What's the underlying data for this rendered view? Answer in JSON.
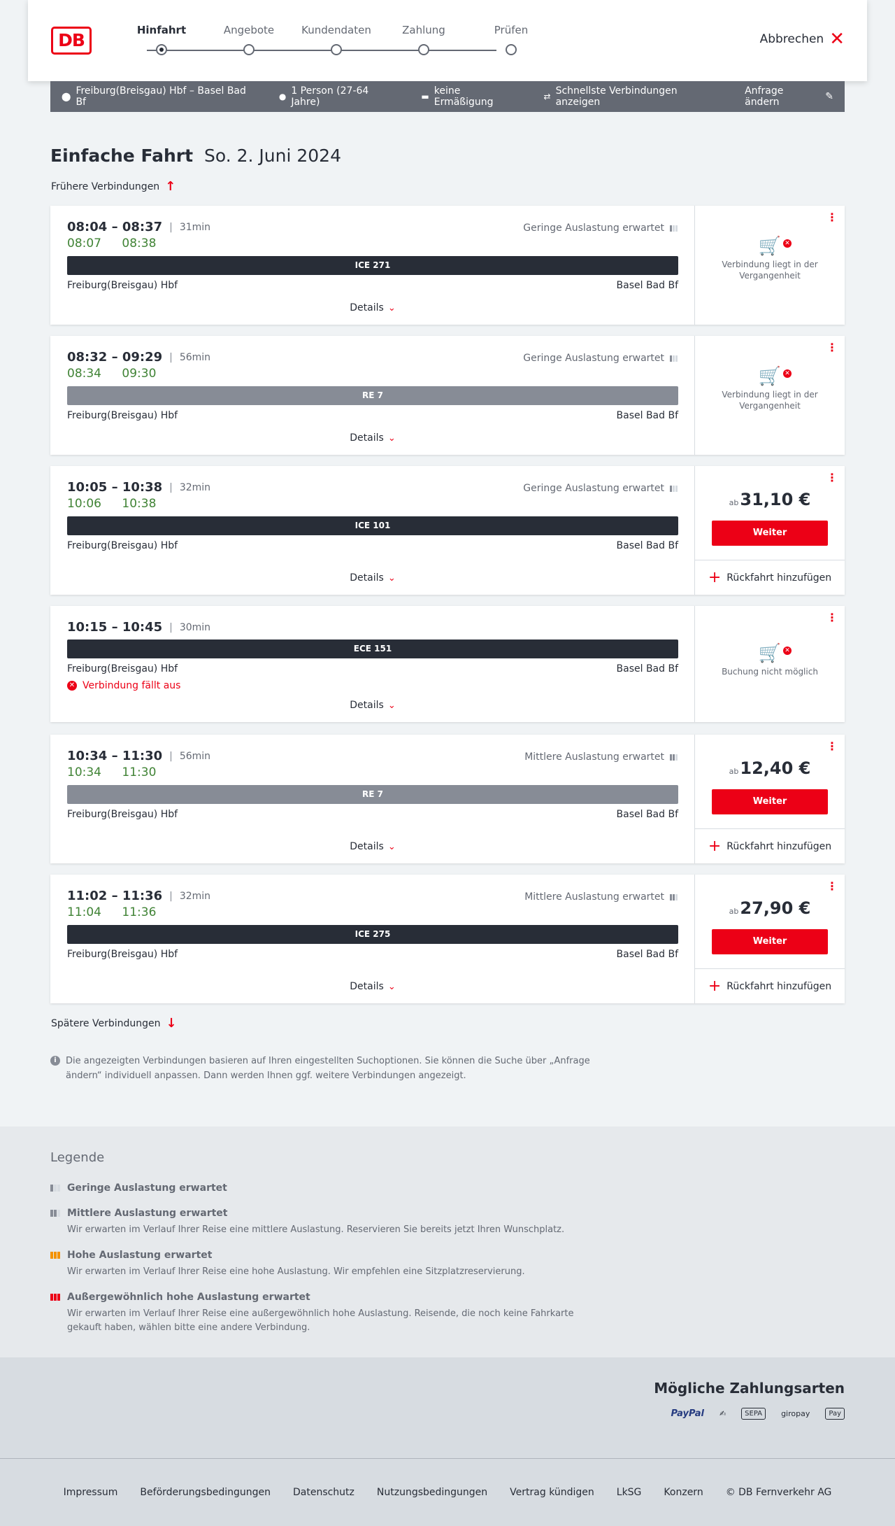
{
  "header": {
    "logo": "DB",
    "steps": [
      "Hinfahrt",
      "Angebote",
      "Kundendaten",
      "Zahlung",
      "Prüfen"
    ],
    "cancel_label": "Abbrechen"
  },
  "searchbar": {
    "route": "Freiburg(Breisgau) Hbf – Basel Bad Bf",
    "persons": "1 Person (27-64 Jahre)",
    "discount": "keine Ermäßigung",
    "fastest": "Schnellste Verbindungen anzeigen",
    "change": "Anfrage ändern"
  },
  "title": {
    "type": "Einfache Fahrt",
    "date": "So. 2. Juni 2024"
  },
  "earlier": "Frühere Verbindungen",
  "later": "Spätere Verbindungen",
  "common": {
    "details": "Details",
    "from": "Freiburg(Breisgau) Hbf",
    "to": "Basel Bad Bf",
    "weiter": "Weiter",
    "return": "Rückfahrt hinzufügen",
    "price_prefix": "ab",
    "past": "Verbindung liegt in der Vergangenheit",
    "not_possible": "Buchung nicht möglich",
    "cancelled": "Verbindung fällt aus"
  },
  "connections": [
    {
      "time": "08:04 – 08:37",
      "duration": "31min",
      "rt_dep": "08:07",
      "rt_arr": "08:38",
      "load": "Geringe Auslastung erwartet",
      "load_level": 1,
      "train": "ICE 271",
      "train_style": "dark",
      "status": "past"
    },
    {
      "time": "08:32 – 09:29",
      "duration": "56min",
      "rt_dep": "08:34",
      "rt_arr": "09:30",
      "load": "Geringe Auslastung erwartet",
      "load_level": 1,
      "train": "RE 7",
      "train_style": "grey",
      "status": "past"
    },
    {
      "time": "10:05 – 10:38",
      "duration": "32min",
      "rt_dep": "10:06",
      "rt_arr": "10:38",
      "load": "Geringe Auslastung erwartet",
      "load_level": 1,
      "train": "ICE 101",
      "train_style": "dark",
      "status": "bookable",
      "price": "31,10 €"
    },
    {
      "time": "10:15 – 10:45",
      "duration": "30min",
      "train": "ECE 151",
      "train_style": "dark",
      "status": "cancelled"
    },
    {
      "time": "10:34 – 11:30",
      "duration": "56min",
      "rt_dep": "10:34",
      "rt_arr": "11:30",
      "load": "Mittlere Auslastung erwartet",
      "load_level": 2,
      "train": "RE 7",
      "train_style": "grey",
      "status": "bookable",
      "price": "12,40 €"
    },
    {
      "time": "11:02 – 11:36",
      "duration": "32min",
      "rt_dep": "11:04",
      "rt_arr": "11:36",
      "load": "Mittlere Auslastung erwartet",
      "load_level": 2,
      "train": "ICE 275",
      "train_style": "dark",
      "status": "bookable",
      "price": "27,90 €"
    }
  ],
  "info": "Die angezeigten Verbindungen basieren auf Ihren eingestellten Suchoptionen. Sie können die Suche über „Anfrage ändern“ individuell anpassen. Dann werden Ihnen ggf. weitere Verbindungen angezeigt.",
  "legend": {
    "title": "Legende",
    "items": [
      {
        "title": "Geringe Auslastung erwartet",
        "desc": ""
      },
      {
        "title": "Mittlere Auslastung erwartet",
        "desc": "Wir erwarten im Verlauf Ihrer Reise eine mittlere Auslastung. Reservieren Sie bereits jetzt Ihren Wunschplatz."
      },
      {
        "title": "Hohe Auslastung erwartet",
        "desc": "Wir erwarten im Verlauf Ihrer Reise eine hohe Auslastung. Wir empfehlen eine Sitzplatzreservierung."
      },
      {
        "title": "Außergewöhnlich hohe Auslastung erwartet",
        "desc": "Wir erwarten im Verlauf Ihrer Reise eine außergewöhnlich hohe Auslastung. Reisende, die noch keine Fahrkarte gekauft haben, wählen bitte eine andere Verbindung."
      }
    ]
  },
  "payment": {
    "title": "Mögliche Zahlungsarten",
    "methods": [
      "PayPal",
      "SEPA",
      "giropay",
      "Pay"
    ]
  },
  "footer": [
    "Impressum",
    "Beförderungsbedingungen",
    "Datenschutz",
    "Nutzungsbedingungen",
    "Vertrag kündigen",
    "LkSG",
    "Konzern",
    "© DB Fernverkehr AG"
  ]
}
